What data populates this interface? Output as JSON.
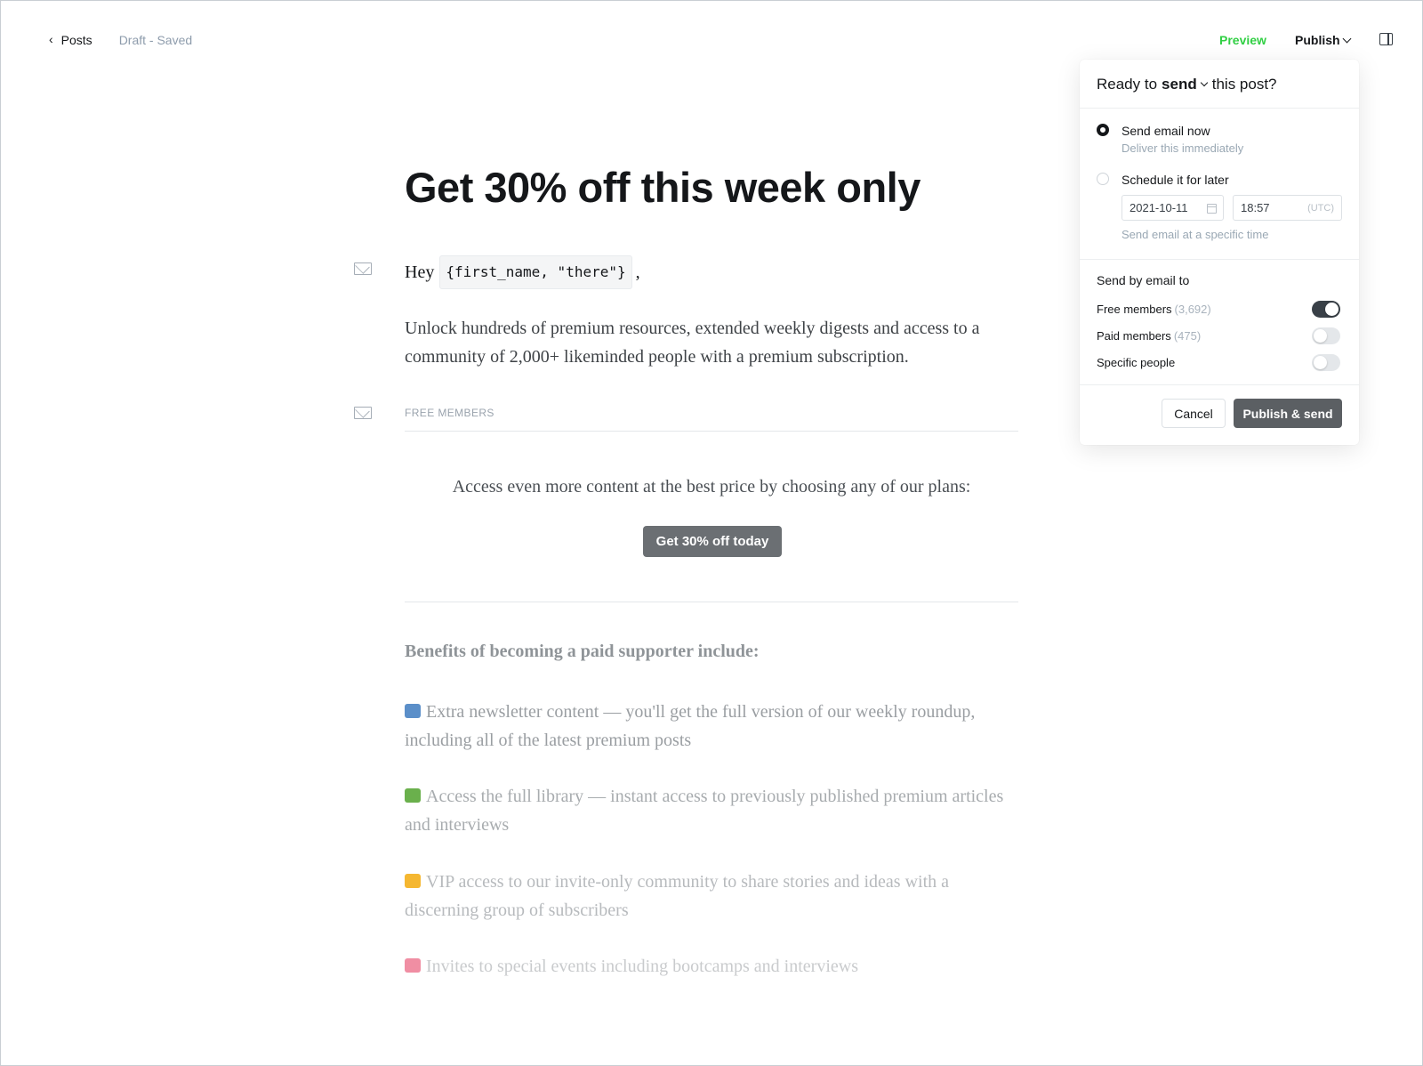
{
  "topbar": {
    "back_label": "Posts",
    "status": "Draft - Saved",
    "preview_label": "Preview",
    "publish_label": "Publish"
  },
  "editor": {
    "title": "Get 30% off this week only",
    "greeting_prefix": "Hey",
    "greeting_code": "{first_name, \"there\"}",
    "greeting_suffix": ",",
    "unlock_text": "Unlock hundreds of premium resources, extended weekly digests and access to a community of 2,000+ likeminded people with a premium subscription.",
    "segment_label": "FREE MEMBERS",
    "cta_text": "Access even more content at the best price by choosing any of our plans:",
    "cta_button": "Get 30% off today",
    "benefits_title": "Benefits of becoming a paid supporter include:",
    "benefits": [
      {
        "emoji_color": "#5b8fc9",
        "text": "Extra newsletter content — you'll get the full version of our weekly roundup, including all of the latest premium posts"
      },
      {
        "emoji_color": "#6ab04c",
        "text": "Access the full library — instant access to previously published premium articles and interviews"
      },
      {
        "emoji_color": "#f5b731",
        "text": "VIP access to our invite-only community to share stories and ideas with a discerning group of subscribers"
      },
      {
        "emoji_color": "#f08ea3",
        "text": "Invites to special events including bootcamps and interviews"
      }
    ]
  },
  "popover": {
    "head_prefix": "Ready to",
    "head_action": "send",
    "head_suffix": "this post?",
    "option_now_label": "Send email now",
    "option_now_sub": "Deliver this immediately",
    "option_later_label": "Schedule it for later",
    "date_value": "2021-10-11",
    "time_value": "18:57",
    "timezone": "(UTC)",
    "schedule_hint": "Send email at a specific time",
    "send_by_label": "Send by email to",
    "members": [
      {
        "label": "Free members",
        "count": "(3,692)",
        "enabled": true
      },
      {
        "label": "Paid members",
        "count": "(475)",
        "enabled": false
      },
      {
        "label": "Specific people",
        "count": "",
        "enabled": false
      }
    ],
    "cancel_label": "Cancel",
    "publish_send_label": "Publish & send"
  },
  "colors": {
    "accent_green": "#30cf43",
    "dark": "#15171a",
    "muted": "#8e9cac"
  }
}
